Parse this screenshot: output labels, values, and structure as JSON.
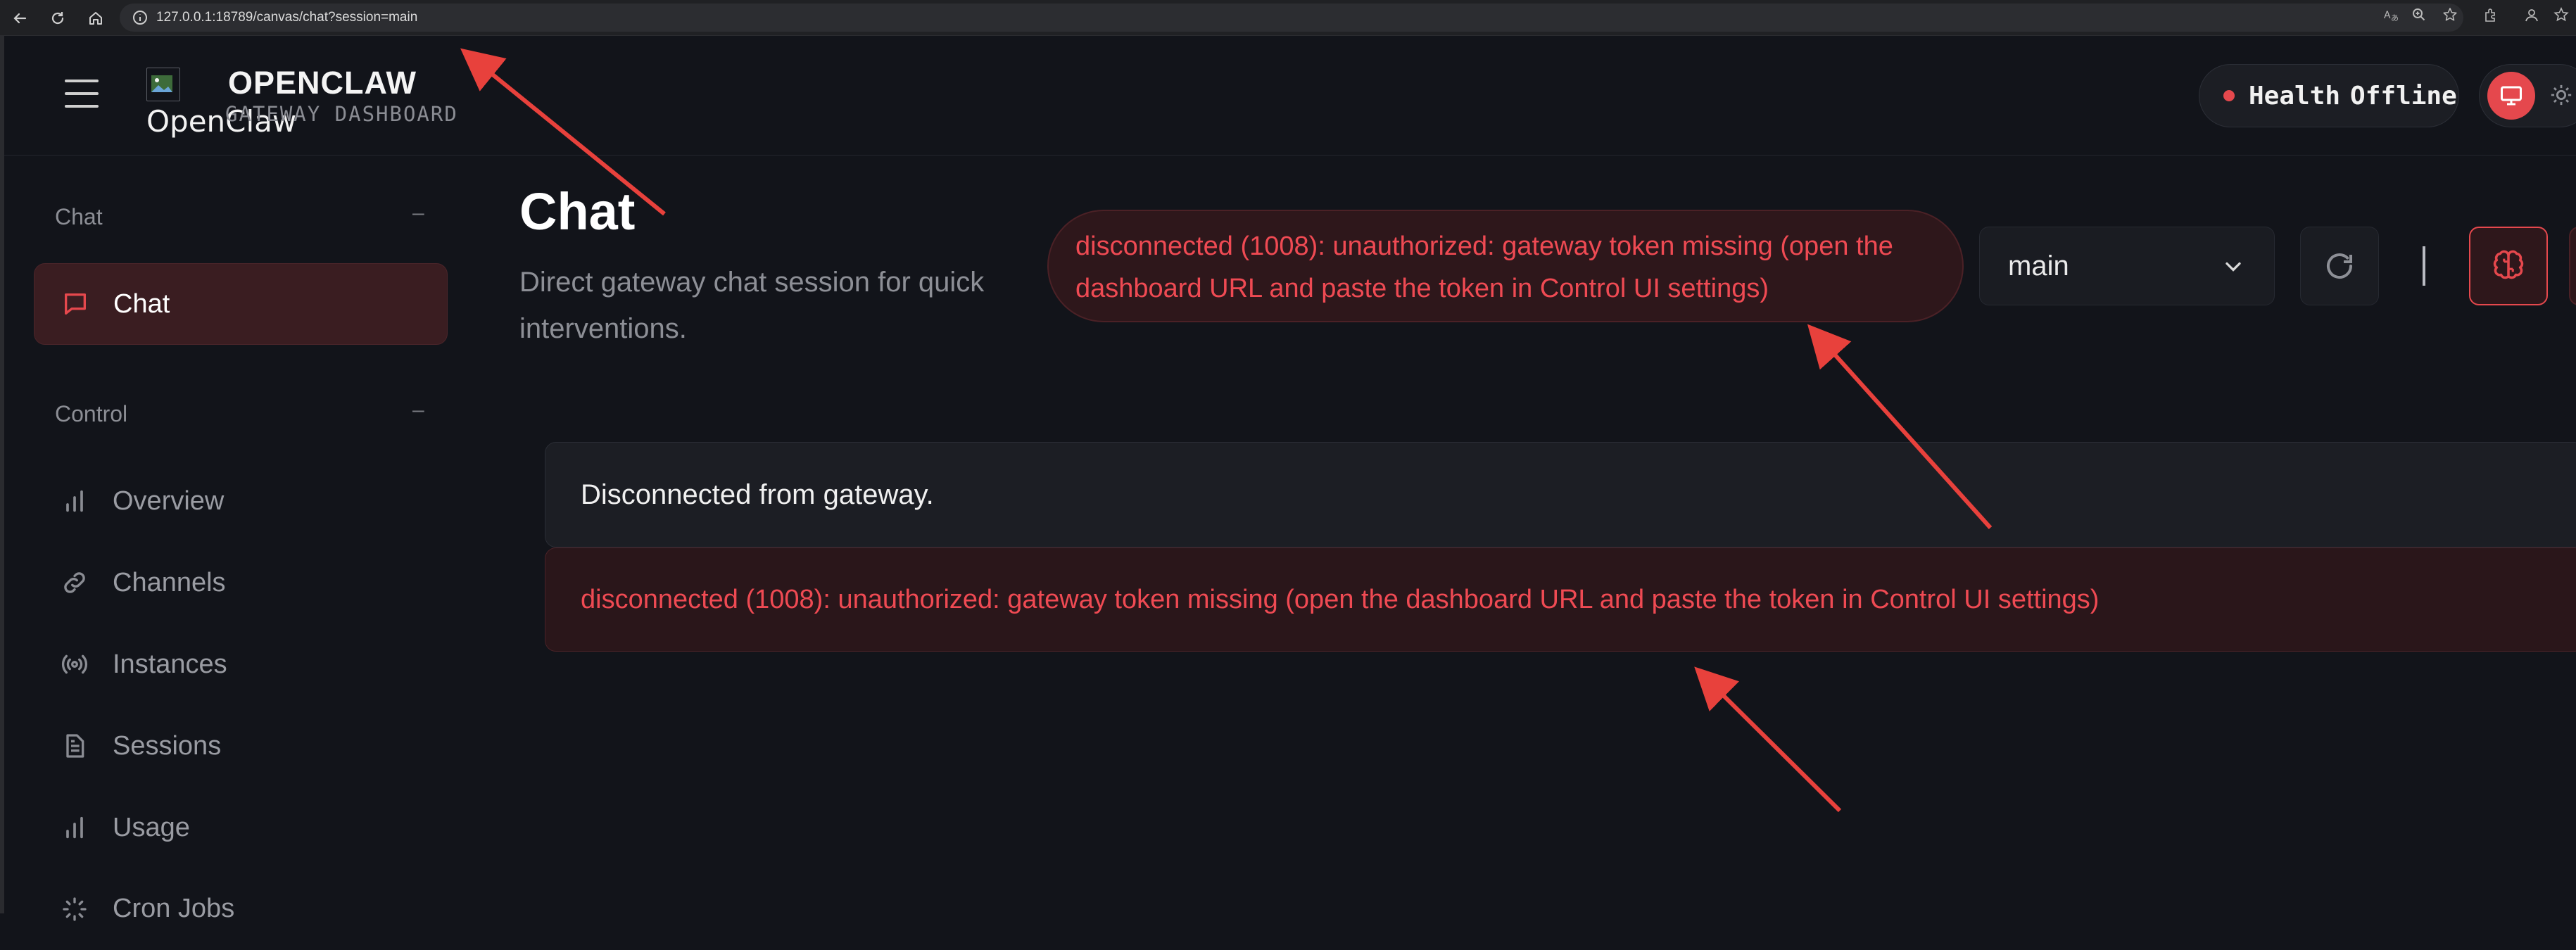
{
  "browser": {
    "url": "127.0.0.1:18789/canvas/chat?session=main",
    "nav_icons": [
      "back-icon",
      "reload-icon",
      "home-icon",
      "site-info-icon"
    ],
    "toolbar_icons": [
      "translate-icon",
      "zoom-icon",
      "bookmark-star-icon",
      "extensions-icon",
      "profile-icon",
      "bookmark-icon"
    ]
  },
  "header": {
    "logo_alt": "OpenClaw",
    "brand_title": "OPENCLAW",
    "brand_subtitle": "GATEWAY DASHBOARD",
    "health_label": "Health",
    "health_status": "Offline",
    "health_color": "#e5484d"
  },
  "sidebar": {
    "groups": [
      {
        "label": "Chat",
        "toggle": "–"
      },
      {
        "label": "Control",
        "toggle": "–"
      }
    ],
    "items": [
      {
        "label": "Chat",
        "icon": "message-square-icon",
        "active": true
      },
      {
        "label": "Overview",
        "icon": "bar-chart-icon"
      },
      {
        "label": "Channels",
        "icon": "link-icon"
      },
      {
        "label": "Instances",
        "icon": "radio-broadcast-icon"
      },
      {
        "label": "Sessions",
        "icon": "file-text-icon"
      },
      {
        "label": "Usage",
        "icon": "bar-chart-icon"
      },
      {
        "label": "Cron Jobs",
        "icon": "cron-icon"
      }
    ]
  },
  "main": {
    "title": "Chat",
    "subtitle": "Direct gateway chat session for quick interventions.",
    "error_pill": "disconnected (1008): unauthorized: gateway token missing (open the dashboard URL and paste the token in Control UI settings)",
    "session_value": "main",
    "messages": [
      {
        "type": "info",
        "text": "Disconnected from gateway."
      },
      {
        "type": "error",
        "text": "disconnected (1008): unauthorized: gateway token missing (open the dashboard URL and paste the token in Control UI settings)"
      }
    ]
  },
  "colors": {
    "accent": "#e5484d",
    "background": "#12141a",
    "annotation_arrow": "#e8413c"
  }
}
